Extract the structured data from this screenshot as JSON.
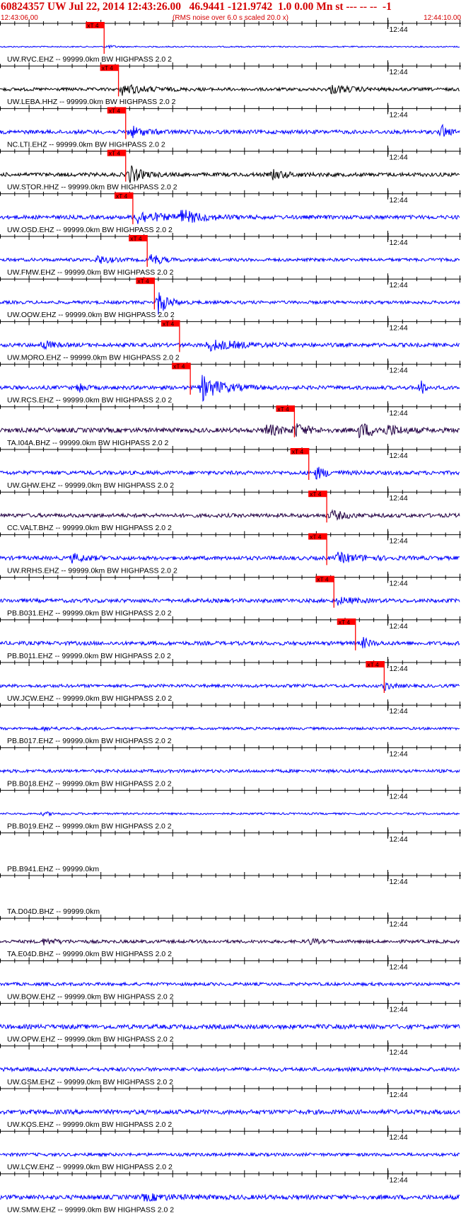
{
  "header": {
    "title": "60824357 UW Jul 22, 2014 12:43:26.00   46.9441 -121.9742  1.0 0.00 Mn st --- -- --  -1",
    "start_time": "12:43:06.00",
    "rms_note": "(RMS noise over 6.0 s scaled 20.0 x)",
    "end_time": "12:44:10.00"
  },
  "colors": {
    "title": "#d40000",
    "pick": "#ff0000",
    "blue_trace": "#0000ff",
    "black_trace": "#000000",
    "purple_trace": "#220044"
  },
  "chart_data": {
    "type": "line",
    "title": "",
    "x_axis": {
      "start": "12:43:06.00",
      "end": "12:44:10.00",
      "unit": "s",
      "range_s": [
        0,
        64
      ],
      "minute_label": "12:44"
    },
    "pick_label": "xT 4",
    "traces": [
      {
        "label": "UW.RVC.EHZ -- 99999.0km BW  HIGHPASS  2.0  2",
        "color": "blue",
        "pick_s": 14.5,
        "amp": 0.1,
        "events": [
          [
            14.8,
            0.25,
            1.0
          ]
        ]
      },
      {
        "label": "UW.LEBA.HHZ -- 99999.0km BW  HIGHPASS  2.0  2",
        "color": "black",
        "pick_s": 16.5,
        "amp": 0.25,
        "events": [
          [
            17,
            0.8,
            3.0
          ],
          [
            46,
            0.6,
            3.0
          ]
        ]
      },
      {
        "label": "NC.LTI.EHZ -- 99999.0km BW  HIGHPASS  2.0  2",
        "color": "blue",
        "pick_s": 17.5,
        "amp": 0.3,
        "events": [
          [
            18,
            0.9,
            2.0
          ],
          [
            61.5,
            1.2,
            0.7
          ]
        ]
      },
      {
        "label": "UW.STOR.HHZ -- 99999.0km BW  HIGHPASS  2.0  2",
        "color": "black",
        "pick_s": 17.5,
        "amp": 0.3,
        "events": [
          [
            18,
            1.4,
            1.5
          ],
          [
            38,
            0.6,
            2.0
          ]
        ]
      },
      {
        "label": "UW.OSD.EHZ -- 99999.0km BW  HIGHPASS  2.0  2",
        "color": "blue",
        "pick_s": 18.5,
        "amp": 0.3,
        "events": [
          [
            19,
            1.0,
            3.0
          ],
          [
            25,
            1.0,
            3.0
          ]
        ]
      },
      {
        "label": "UW.FMW.EHZ -- 99999.0km BW  HIGHPASS  2.0  2",
        "color": "blue",
        "pick_s": 20.5,
        "amp": 0.25,
        "events": [
          [
            13.5,
            0.7,
            1.5
          ],
          [
            21,
            1.1,
            1.2
          ]
        ]
      },
      {
        "label": "UW.OOW.EHZ -- 99999.0km BW  HIGHPASS  2.0  2",
        "color": "blue",
        "pick_s": 21.5,
        "amp": 0.25,
        "events": [
          [
            22,
            2.0,
            1.2
          ]
        ]
      },
      {
        "label": "UW.MORO.EHZ -- 99999.0km BW  HIGHPASS  2.0  2",
        "color": "blue",
        "pick_s": 25.0,
        "amp": 0.3,
        "events": [
          [
            6,
            0.8,
            1.0
          ],
          [
            29,
            0.8,
            4.0
          ]
        ]
      },
      {
        "label": "UW.RCS.EHZ -- 99999.0km BW  HIGHPASS  2.0  2",
        "color": "blue",
        "pick_s": 26.5,
        "amp": 0.3,
        "events": [
          [
            11,
            1.0,
            0.6
          ],
          [
            28,
            2.0,
            2.5
          ],
          [
            58.5,
            2.0,
            0.4
          ]
        ]
      },
      {
        "label": "TA.I04A.BHZ -- 99999.0km BW  HIGHPASS  2.0  2",
        "color": "purple",
        "pick_s": 41.0,
        "amp": 0.35,
        "events": [
          [
            37,
            0.9,
            2.0
          ],
          [
            41,
            1.0,
            1.5
          ],
          [
            50,
            1.0,
            3.0
          ],
          [
            54,
            0.6,
            1.5
          ]
        ]
      },
      {
        "label": "UW.GHW.EHZ -- 99999.0km BW  HIGHPASS  2.0  2",
        "color": "blue",
        "pick_s": 43.0,
        "amp": 0.3,
        "events": [
          [
            44,
            0.9,
            1.5
          ]
        ]
      },
      {
        "label": "CC.VALT.BHZ -- 99999.0km BW  HIGHPASS  2.0  2",
        "color": "purple",
        "pick_s": 45.5,
        "amp": 0.3,
        "events": [
          [
            46,
            0.7,
            2.0
          ]
        ]
      },
      {
        "label": "UW.RRHS.EHZ -- 99999.0km BW  HIGHPASS  2.0  2",
        "color": "blue",
        "pick_s": 45.5,
        "amp": 0.3,
        "events": [
          [
            10,
            0.6,
            2.0
          ],
          [
            47,
            0.7,
            3.0
          ]
        ]
      },
      {
        "label": "PB.B031.EHZ -- 99999.0km BW  HIGHPASS  2.0  2",
        "color": "blue",
        "pick_s": 46.5,
        "amp": 0.3,
        "events": [
          [
            47,
            0.5,
            2.0
          ]
        ]
      },
      {
        "label": "PB.B011.EHZ -- 99999.0km BW  HIGHPASS  2.0  2",
        "color": "blue",
        "pick_s": 49.5,
        "amp": 0.3,
        "events": [
          [
            50.5,
            0.8,
            1.0
          ]
        ]
      },
      {
        "label": "UW.JCW.EHZ -- 99999.0km BW  HIGHPASS  2.0  2",
        "color": "blue",
        "pick_s": 53.5,
        "amp": 0.25,
        "events": [
          [
            53.5,
            0.6,
            1.0
          ]
        ]
      },
      {
        "label": "PB.B017.EHZ -- 99999.0km BW  HIGHPASS  2.0  2",
        "color": "blue",
        "pick_s": null,
        "amp": 0.2,
        "events": [
          [
            6,
            0.2,
            2.0
          ]
        ]
      },
      {
        "label": "PB.B018.EHZ -- 99999.0km BW  HIGHPASS  2.0  2",
        "color": "blue",
        "pick_s": null,
        "amp": 0.25,
        "events": []
      },
      {
        "label": "PB.B019.EHZ -- 99999.0km BW  HIGHPASS  2.0  2",
        "color": "blue",
        "pick_s": null,
        "amp": 0.15,
        "events": [
          [
            6,
            0.2,
            2.0
          ]
        ]
      },
      {
        "label": "PB.B941.EHZ -- 99999.0km",
        "color": "blue",
        "pick_s": null,
        "amp": 0,
        "events": []
      },
      {
        "label": "TA.D04D.BHZ -- 99999.0km",
        "color": "blue",
        "pick_s": null,
        "amp": 0,
        "events": []
      },
      {
        "label": "TA.E04D.BHZ -- 99999.0km BW  HIGHPASS  2.0  2",
        "color": "purple",
        "pick_s": null,
        "amp": 0.25,
        "events": [
          [
            6,
            0.4,
            2.0
          ],
          [
            43,
            0.5,
            1.0
          ]
        ]
      },
      {
        "label": "UW.BOW.EHZ -- 99999.0km BW  HIGHPASS  2.0  2",
        "color": "blue",
        "pick_s": null,
        "amp": 0.25,
        "events": []
      },
      {
        "label": "UW.OPW.EHZ -- 99999.0km BW  HIGHPASS  2.0  2",
        "color": "blue",
        "pick_s": null,
        "amp": 0.35,
        "events": []
      },
      {
        "label": "UW.GSM.EHZ -- 99999.0km BW  HIGHPASS  2.0  2",
        "color": "blue",
        "pick_s": null,
        "amp": 0.3,
        "events": []
      },
      {
        "label": "UW.KOS.EHZ -- 99999.0km BW  HIGHPASS  2.0  2",
        "color": "blue",
        "pick_s": null,
        "amp": 0.35,
        "events": []
      },
      {
        "label": "UW.LCW.EHZ -- 99999.0km BW  HIGHPASS  2.0  2",
        "color": "blue",
        "pick_s": null,
        "amp": 0.25,
        "events": []
      },
      {
        "label": "UW.SMW.EHZ -- 99999.0km BW  HIGHPASS  2.0  2",
        "color": "blue",
        "pick_s": null,
        "amp": 0.35,
        "events": [
          [
            20,
            0.4,
            4.0
          ]
        ]
      }
    ]
  }
}
